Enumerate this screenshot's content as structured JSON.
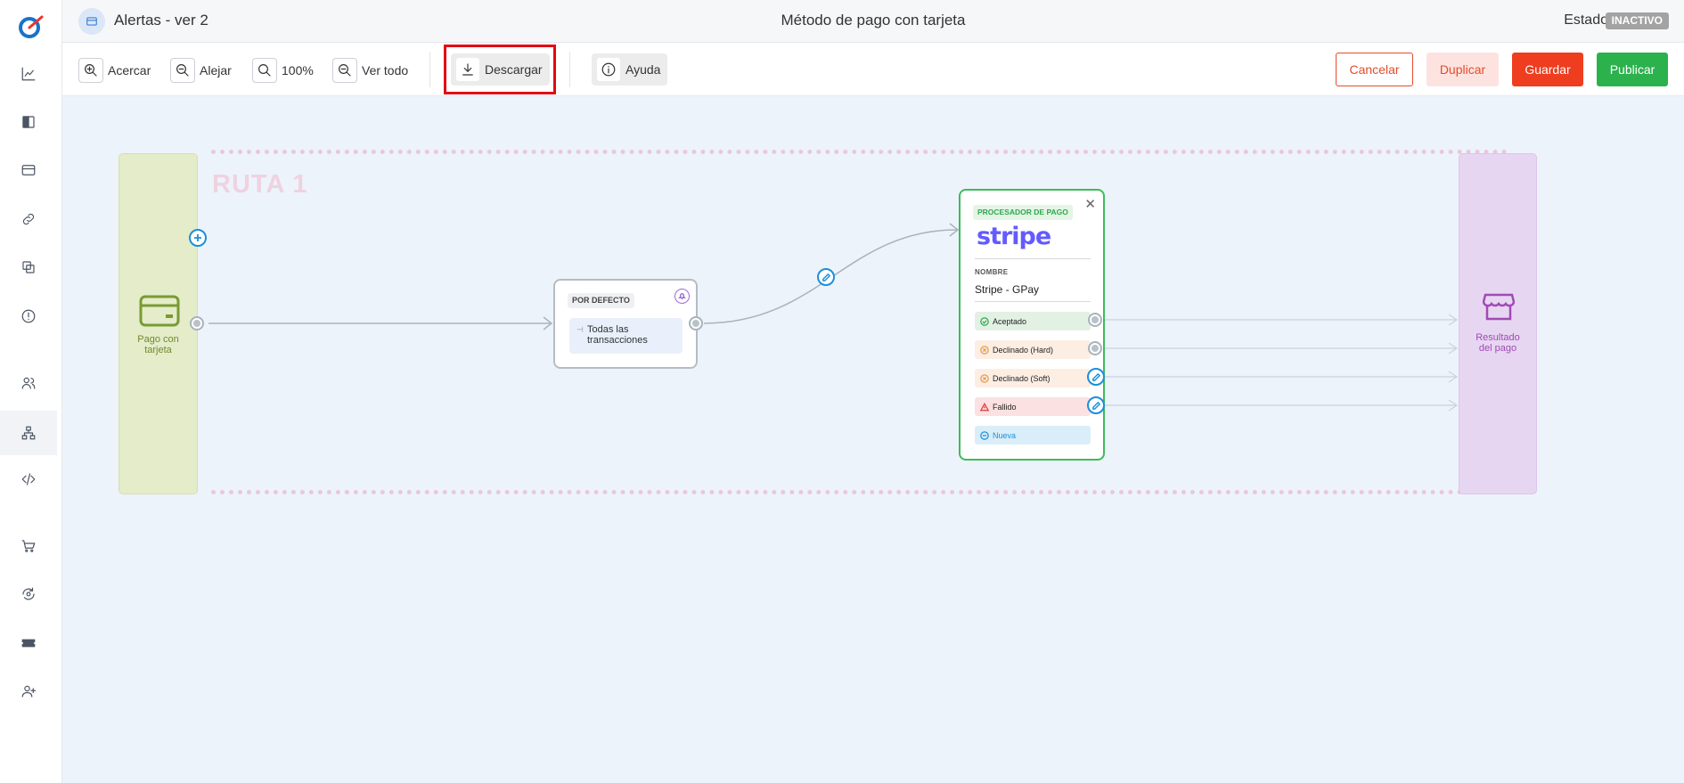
{
  "header": {
    "title": "Alertas - ver 2",
    "center_title": "Método de pago con tarjeta",
    "estado_label": "Estado",
    "estado_badge": "INACTIVO"
  },
  "toolbar": {
    "zoom_in": "Acercar",
    "zoom_out": "Alejar",
    "zoom_level": "100%",
    "fit_all": "Ver todo",
    "download": "Descargar",
    "help": "Ayuda",
    "cancel": "Cancelar",
    "duplicate": "Duplicar",
    "save": "Guardar",
    "publish": "Publicar"
  },
  "sidebar": {
    "items": [
      {
        "icon": "chart-icon"
      },
      {
        "icon": "book-icon"
      },
      {
        "icon": "credit-card-icon"
      },
      {
        "icon": "link-icon"
      },
      {
        "icon": "copy-icon"
      },
      {
        "icon": "alert-icon"
      },
      {
        "icon": "users-icon"
      },
      {
        "icon": "sitemap-icon",
        "active": true
      },
      {
        "icon": "code-icon"
      },
      {
        "icon": "cart-icon"
      },
      {
        "icon": "refresh-eye-icon"
      },
      {
        "icon": "ticket-icon"
      },
      {
        "icon": "user-plus-icon"
      }
    ]
  },
  "canvas": {
    "route_label": "RUTA 1",
    "start_node": {
      "label_1": "Pago con",
      "label_2": "tarjeta"
    },
    "end_node": {
      "label_1": "Resultado",
      "label_2": "del pago"
    },
    "default_node": {
      "tag": "POR DEFECTO",
      "condition_1": "Todas las",
      "condition_2": "transacciones"
    },
    "processor_node": {
      "tag": "PROCESADOR DE PAGO",
      "brand": "stripe",
      "name_label": "NOMBRE",
      "name_value": "Stripe - GPay",
      "outputs": [
        {
          "label": "Aceptado",
          "color": "#e3f1e4"
        },
        {
          "label": "Declinado (Hard)",
          "color": "#fdeee3"
        },
        {
          "label": "Declinado (Soft)",
          "color": "#fdeee3"
        },
        {
          "label": "Fallido",
          "color": "#fbe1e1"
        },
        {
          "label": "Nueva",
          "color": "#d9eef8"
        }
      ]
    }
  },
  "colors": {
    "accent_red": "#ee3d1f",
    "publish_green": "#2bb24c",
    "stripe_purple": "#635bff",
    "highlight_red": "#e30613"
  }
}
